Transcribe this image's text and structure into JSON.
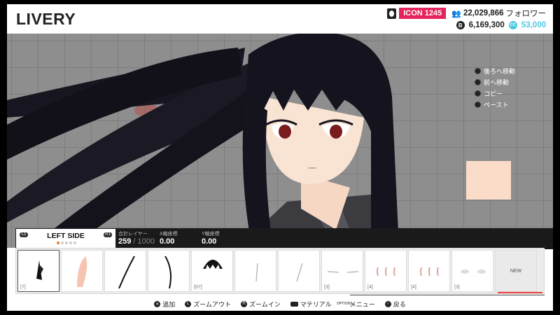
{
  "header": {
    "title": "LIVERY",
    "icon_label": "ICON 1245",
    "followers_count": "22,029,866",
    "followers_label": "フォロワー",
    "credits": "6,169,300",
    "cc_points": "53,000",
    "credits_icon_glyph": "B",
    "cc_icon_glyph": "CC"
  },
  "context_menu": {
    "items": [
      {
        "label": "後ろへ移動"
      },
      {
        "label": "前へ移動"
      },
      {
        "label": "コピー"
      },
      {
        "label": "ペースト"
      }
    ]
  },
  "layer_panel": {
    "tab_title": "LEFT SIDE",
    "left_bumper": "L1",
    "right_bumper": "R1",
    "total_layers_label": "合計レイヤー",
    "total_layers_value": "259",
    "total_layers_max": "/ 1000",
    "x_label": "X軸座標",
    "x_value": "0.00",
    "y_label": "Y軸座標",
    "y_value": "0.00"
  },
  "thumbnails": [
    {
      "count": "[7]"
    },
    {
      "count": ""
    },
    {
      "count": ""
    },
    {
      "count": ""
    },
    {
      "count": "[67]"
    },
    {
      "count": ""
    },
    {
      "count": ""
    },
    {
      "count": "[3]"
    },
    {
      "count": "[4]"
    },
    {
      "count": "[4]"
    },
    {
      "count": "[3]"
    },
    {
      "count": "",
      "label": "NEW"
    }
  ],
  "footer": {
    "items": [
      {
        "label": "追加"
      },
      {
        "label": "ズームアウト"
      },
      {
        "label": "ズームイン"
      },
      {
        "label": "マテリアル"
      },
      {
        "label": "メニュー"
      },
      {
        "label": "戻る"
      }
    ],
    "options_label": "OPTIONS"
  },
  "colors": {
    "accent": "#e3245a",
    "cc": "#4ec9e0",
    "swatch": "#fbdcc9",
    "hair": "#15131d",
    "eye": "#7a1c1c"
  }
}
